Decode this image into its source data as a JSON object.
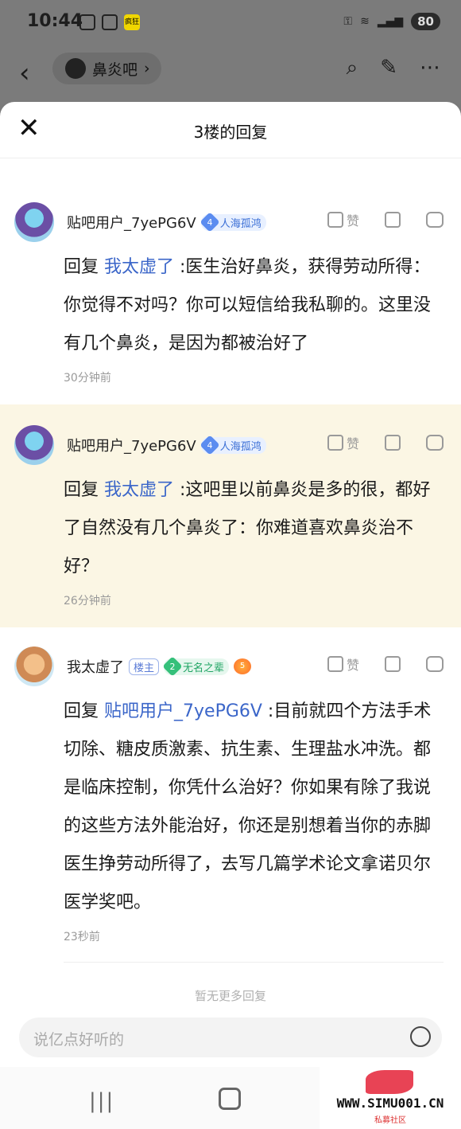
{
  "status": {
    "time": "10:44",
    "app_icon_text": "疯狂",
    "battery": "80"
  },
  "nav": {
    "forum": "鼻炎吧"
  },
  "sheet": {
    "title": "3楼的回复",
    "peek_text": "……"
  },
  "replies": [
    {
      "username": "贴吧用户_7yePG6V",
      "level_num": "4",
      "level_name": "人海孤鸿",
      "like_label": "赞",
      "prefix": "回复",
      "mention": "我太虚了",
      "text": " :医生治好鼻炎，获得劳动所得：你觉得不对吗？你可以短信给我私聊的。这里没有几个鼻炎，是因为都被治好了",
      "time": "30分钟前"
    },
    {
      "username": "贴吧用户_7yePG6V",
      "level_num": "4",
      "level_name": "人海孤鸿",
      "like_label": "赞",
      "prefix": "回复",
      "mention": "我太虚了",
      "text": " :这吧里以前鼻炎是多的很，都好了自然没有几个鼻炎了：你难道喜欢鼻炎治不好？",
      "time": "26分钟前"
    },
    {
      "username": "我太虚了",
      "owner_badge": "楼主",
      "level_num": "2",
      "level_name": "无名之辈",
      "flame_num": "5",
      "like_label": "赞",
      "prefix": "回复",
      "mention": "贴吧用户_7yePG6V",
      "text": " :目前就四个方法手术切除、糖皮质激素、抗生素、生理盐水冲洗。都是临床控制，你凭什么治好？你如果有除了我说的这些方法外能治好，你还是别想着当你的赤脚医生挣劳动所得了，去写几篇学术论文拿诺贝尔医学奖吧。",
      "time": "23秒前"
    }
  ],
  "footer": {
    "no_more": "暂无更多回复",
    "input_placeholder": "说亿点好听的"
  },
  "watermark": {
    "url": "WWW.SIMU001.CN",
    "sub": "私募社区"
  },
  "colors": {
    "mention": "#3b66c9",
    "highlight_bg": "#fbf6e4",
    "dim_overlay": "#7b7b7b"
  }
}
